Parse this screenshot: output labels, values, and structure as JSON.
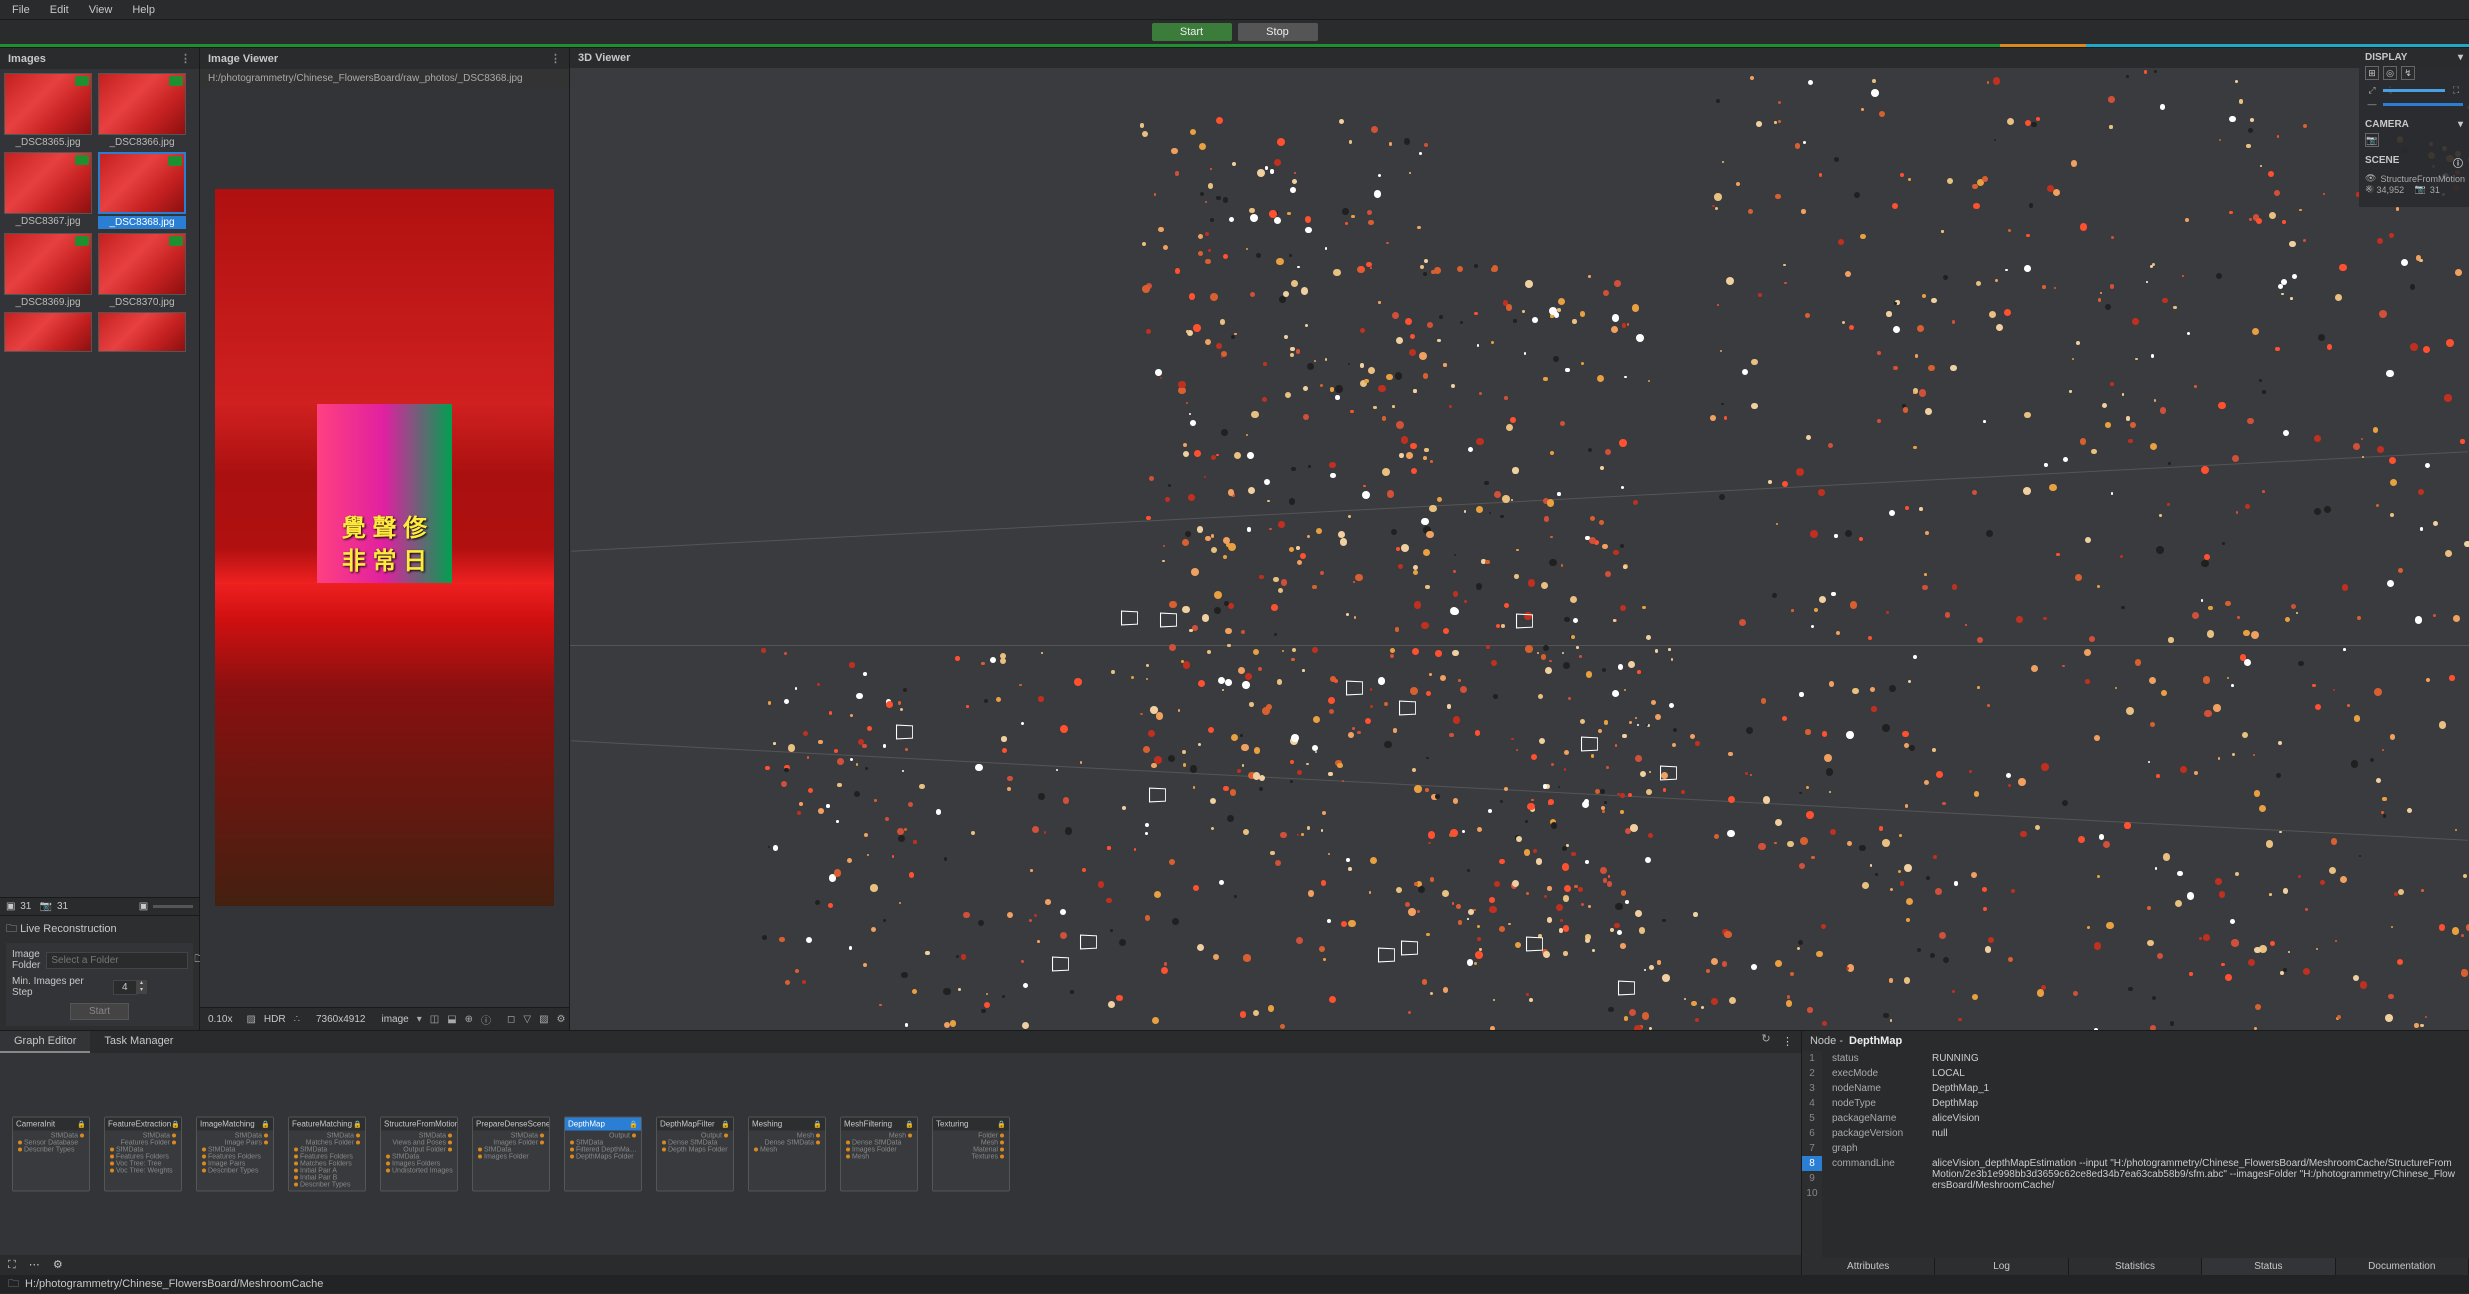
{
  "menu": {
    "items": [
      "File",
      "Edit",
      "View",
      "Help"
    ]
  },
  "runbar": {
    "start": "Start",
    "stop": "Stop"
  },
  "images_panel": {
    "title": "Images",
    "thumbs": [
      {
        "name": "_DSC8365.jpg",
        "selected": false
      },
      {
        "name": "_DSC8366.jpg",
        "selected": false
      },
      {
        "name": "_DSC8367.jpg",
        "selected": false
      },
      {
        "name": "_DSC8368.jpg",
        "selected": true
      },
      {
        "name": "_DSC8369.jpg",
        "selected": false
      },
      {
        "name": "_DSC8370.jpg",
        "selected": false
      }
    ],
    "stats": {
      "image_count": "31",
      "camera_count": "31"
    },
    "live": {
      "title": "Live Reconstruction",
      "folder_label": "Image Folder",
      "folder_placeholder": "Select a Folder",
      "minstep_label": "Min. Images per Step",
      "minstep_value": "4",
      "start_btn": "Start"
    }
  },
  "viewer": {
    "title": "Image Viewer",
    "path": "H:/photogrammetry/Chinese_FlowersBoard/raw_photos/_DSC8368.jpg",
    "zoom": "0.10x",
    "hdr": "HDR",
    "resolution": "7360x4912",
    "mode_label": "image"
  },
  "viewer3d": {
    "title": "3D Viewer",
    "display": {
      "title": "DISPLAY"
    },
    "camera": {
      "title": "CAMERA"
    },
    "scene": {
      "title": "SCENE",
      "name": "StructureFromMotion",
      "points": "34,952",
      "cams": "31"
    }
  },
  "graph": {
    "tabs": [
      "Graph Editor",
      "Task Manager"
    ],
    "active_tab": 0,
    "nodes": [
      {
        "name": "CameraInit",
        "left": [
          "SfMData"
        ],
        "right": [
          "Sensor Database",
          "Describer Types"
        ],
        "sel": false
      },
      {
        "name": "FeatureExtraction",
        "left": [
          "SfMData",
          "Features Folder"
        ],
        "right": [
          "SfMData",
          "Features Folders",
          "Voc Tree: Tree",
          "Voc Tree: Weights"
        ],
        "sel": false
      },
      {
        "name": "ImageMatching",
        "left": [
          "SfMData",
          "Image Pairs"
        ],
        "right": [
          "SfMData",
          "Features Folders",
          "Image Pairs",
          "Describer Types"
        ],
        "sel": false
      },
      {
        "name": "FeatureMatching",
        "left": [
          "SfMData",
          "Matches Folder"
        ],
        "right": [
          "SfMData",
          "Features Folders",
          "Matches Folders",
          "Initial Pair A",
          "Initial Pair B",
          "Describer Types"
        ],
        "sel": false
      },
      {
        "name": "StructureFromMotion",
        "left": [
          "SfMData",
          "Views and Poses",
          "Output Folder"
        ],
        "right": [
          "SfMData",
          "Images Folders",
          "Undistorted Images"
        ],
        "sel": false
      },
      {
        "name": "PrepareDenseScene",
        "left": [
          "SfMData",
          "Images Folder"
        ],
        "right": [
          "SfMData",
          "Images Folder"
        ],
        "sel": false
      },
      {
        "name": "DepthMap",
        "left": [
          "Output"
        ],
        "right": [
          "SfMData",
          "Filtered DepthMaps Folder",
          "DepthMaps Folder"
        ],
        "sel": true
      },
      {
        "name": "DepthMapFilter",
        "left": [
          "Output"
        ],
        "right": [
          "Dense SfMData",
          "Depth Maps Folder"
        ],
        "sel": false
      },
      {
        "name": "Meshing",
        "left": [
          "Mesh",
          "Dense SfMData"
        ],
        "right": [
          "Mesh"
        ],
        "sel": false
      },
      {
        "name": "MeshFiltering",
        "left": [
          "Mesh"
        ],
        "right": [
          "Dense SfMData",
          "Images Folder",
          "Mesh"
        ],
        "sel": false
      },
      {
        "name": "Texturing",
        "left": [
          "Folder",
          "Mesh",
          "Material",
          "Textures"
        ],
        "right": [],
        "sel": false
      }
    ]
  },
  "node_panel": {
    "title_prefix": "Node - ",
    "title": "DepthMap",
    "lines": [
      "1",
      "2",
      "3",
      "4",
      "5",
      "6",
      "7",
      "8",
      "9",
      "10"
    ],
    "selected_line": "8",
    "attrs": [
      {
        "k": "status",
        "v": "RUNNING"
      },
      {
        "k": "execMode",
        "v": "LOCAL"
      },
      {
        "k": "nodeName",
        "v": "DepthMap_1"
      },
      {
        "k": "nodeType",
        "v": "DepthMap"
      },
      {
        "k": "packageName",
        "v": "aliceVision"
      },
      {
        "k": "packageVersion",
        "v": "null"
      },
      {
        "k": "graph",
        "v": ""
      },
      {
        "k": "commandLine",
        "v": "aliceVision_depthMapEstimation  --input \"H:/photogrammetry/Chinese_FlowersBoard/MeshroomCache/StructureFromMotion/2e3b1e998bb3d3659c62ce8ed34b7ea63cab58b9/sfm.abc\" --imagesFolder \"H:/photogrammetry/Chinese_FlowersBoard/MeshroomCache/"
      }
    ],
    "tabs": [
      "Attributes",
      "Log",
      "Statistics",
      "Status",
      "Documentation"
    ],
    "active_tab": 3
  },
  "statusbar": {
    "path": "H:/photogrammetry/Chinese_FlowersBoard/MeshroomCache"
  }
}
